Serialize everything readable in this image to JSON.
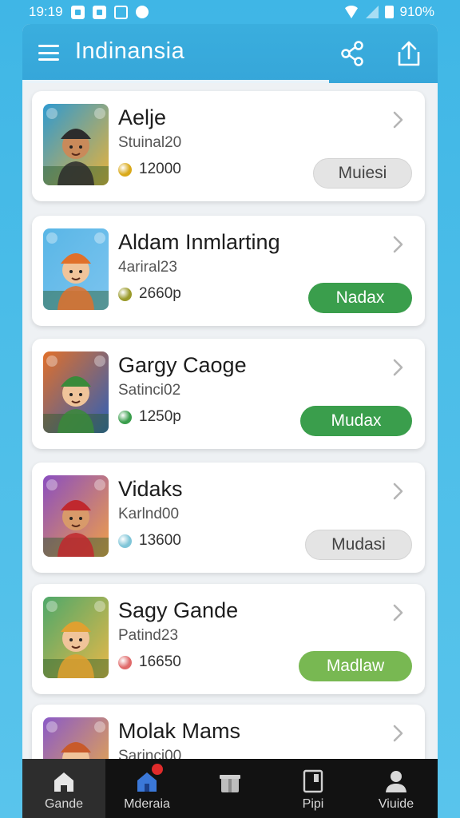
{
  "status_bar": {
    "time": "19:19",
    "battery_text": "910%"
  },
  "header": {
    "title": "Indinansia"
  },
  "list": {
    "items": [
      {
        "title": "Aelje",
        "subtitle": "Stuinal20",
        "coins": "12000",
        "action": "Muiesi",
        "button_style": "gray",
        "coin_color": "#d9a91a",
        "icon_colors": [
          "#2f9ad0",
          "#e9b23a"
        ]
      },
      {
        "title": "Aldam Inmlarting",
        "subtitle": "4ariral23",
        "coins": "2660p",
        "action": "Nadax",
        "button_style": "green",
        "coin_color": "#9a9a2a",
        "icon_colors": [
          "#59b6e6",
          "#7cc4ef"
        ]
      },
      {
        "title": "Gargy Caoge",
        "subtitle": "Satinci02",
        "coins": "1250p",
        "action": "Mudax",
        "button_style": "green",
        "coin_color": "#3a9e4c",
        "icon_colors": [
          "#e1702a",
          "#2d5fb8"
        ]
      },
      {
        "title": "Vidaks",
        "subtitle": "Karlnd00",
        "coins": "13600",
        "action": "Mudasi",
        "button_style": "gray",
        "coin_color": "#7fc5d8",
        "icon_colors": [
          "#8a4ec0",
          "#f0a048"
        ]
      },
      {
        "title": "Sagy Gande",
        "subtitle": "Patind23",
        "coins": "16650",
        "action": "Madlaw",
        "button_style": "lightgreen",
        "coin_color": "#e06a6a",
        "icon_colors": [
          "#4ea86a",
          "#e8b848"
        ]
      },
      {
        "title": "Molak Mams",
        "subtitle": "Sarinci00",
        "coins": "",
        "action": "",
        "button_style": "gray",
        "coin_color": "#d9a91a",
        "icon_colors": [
          "#8a5ac8",
          "#f0b040"
        ]
      }
    ]
  },
  "bottom_nav": {
    "items": [
      {
        "label": "Gande",
        "icon": "home-icon",
        "active": true
      },
      {
        "label": "Mderaia",
        "icon": "home-alt-icon",
        "active": false
      },
      {
        "label": "",
        "icon": "gift-icon",
        "active": false
      },
      {
        "label": "Pipi",
        "icon": "tablet-icon",
        "active": false
      },
      {
        "label": "Viuide",
        "icon": "profile-icon",
        "active": false
      }
    ]
  },
  "colors": {
    "background": "#46b9e7",
    "header": "#38a9db",
    "green_button": "#3a9e4c",
    "light_green_button": "#78b852",
    "nav_background": "#121212"
  }
}
